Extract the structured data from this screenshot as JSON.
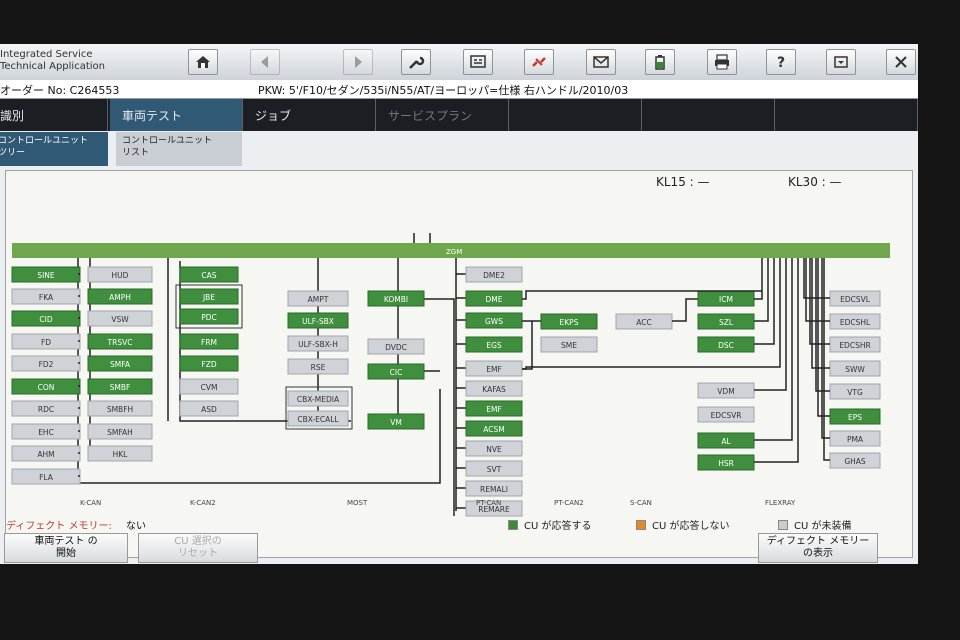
{
  "app": {
    "title_line1": "Integrated Service",
    "title_line2": "Technical Application"
  },
  "info": {
    "order_no": "オーダー No:  C264553",
    "vehicle": "PKW:  5'/F10/セダン/535i/N55/AT/ヨーロッパ=仕様 右ハンドル/2010/03"
  },
  "main_tabs": [
    {
      "label": "識別"
    },
    {
      "label": "車両テスト"
    },
    {
      "label": "ジョブ"
    },
    {
      "label": "サービスプラン"
    },
    {
      "label": ""
    },
    {
      "label": ""
    },
    {
      "label": ""
    }
  ],
  "sub_tabs": [
    {
      "label_l1": "コントロールユニット",
      "label_l2": "ツリー"
    },
    {
      "label_l1": "コントロールユニット",
      "label_l2": "リスト"
    }
  ],
  "kl15": {
    "label": "KL15 :",
    "value": "—"
  },
  "kl30": {
    "label": "KL30 :",
    "value": "—"
  },
  "bus_labels": [
    "K-CAN",
    "K-CAN2",
    "MOST",
    "PT-CAN",
    "PT-CAN2",
    "S-CAN",
    "FLEXRAY"
  ],
  "zgm": "ZGM",
  "units": {
    "c1": [
      "SINE",
      "FKA",
      "CID",
      "FD",
      "FD2",
      "CON",
      "RDC",
      "EHC",
      "AHM",
      "FLA"
    ],
    "c2": [
      "HUD",
      "AMPH",
      "VSW",
      "TRSVC",
      "SMFA",
      "SMBF",
      "SMBFH",
      "SMFAH",
      "HKL"
    ],
    "c3": [
      "CAS",
      "JBE",
      "PDC",
      "FRM",
      "FZD",
      "CVM",
      "ASD"
    ],
    "c4": [
      "AMPT",
      "ULF-SBX",
      "ULF-SBX-H",
      "RSE",
      "CBX-MEDIA",
      "CBX-ECALL"
    ],
    "c5": [
      "KOMBI",
      "DVDC",
      "CIC",
      "VM"
    ],
    "c6": [
      "DME2",
      "DME",
      "GWS",
      "EGS",
      "EMF",
      "KAFAS",
      "EMF",
      "ACSM",
      "NVE",
      "SVT",
      "REMALI",
      "REMARE"
    ],
    "c7": [
      "EKPS",
      "SME"
    ],
    "c8": [
      "ACC"
    ],
    "c9": [
      "ICM",
      "SZL",
      "DSC"
    ],
    "c10": [
      "VDM",
      "EDCSVR",
      "AL",
      "HSR"
    ],
    "c11": [
      "EDCSVL",
      "EDCSHL",
      "EDCSHR",
      "SWW",
      "VTG",
      "EPS",
      "PMA",
      "GHAS"
    ]
  },
  "status": {
    "fault_label": "ディフェクト メモリー:",
    "fault_value": "ない",
    "legend_ok": "CU が応答する",
    "legend_no_response": "CU が応答しない",
    "legend_not_installed": "CU が未装備",
    "colors": {
      "responds": "#3a8b3a",
      "not_responding": "#e08a2e",
      "not_installed": "#c8cbd0",
      "bus": "#6fa84c"
    }
  },
  "buttons": {
    "start_test_l1": "車両テスト の",
    "start_test_l2": "開始",
    "disabled_l1": "CU 選択の",
    "disabled_l2": "リセット",
    "fault_mem_l1": "ディフェクト メモリー",
    "fault_mem_l2": "の表示"
  },
  "toolbar_icons": [
    "home-icon",
    "back-icon",
    "forward-icon",
    "wrench-icon",
    "diagnosis-icon",
    "connection-icon",
    "mail-icon",
    "battery-icon",
    "print-icon",
    "help-icon",
    "minimize-icon",
    "close-icon"
  ]
}
